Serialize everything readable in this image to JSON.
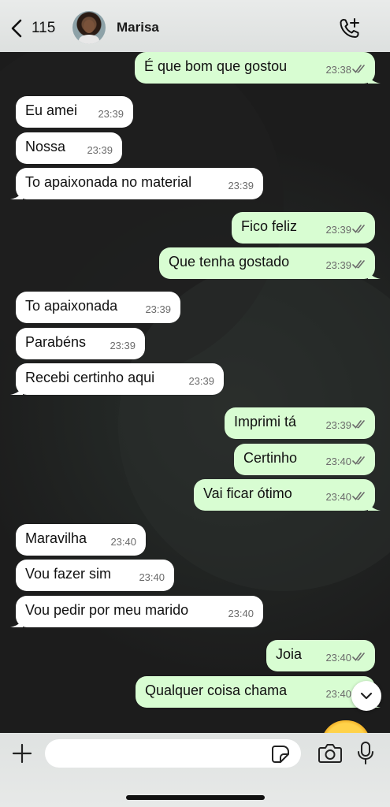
{
  "header": {
    "back_count": "115",
    "contact_name": "Marisa"
  },
  "messages": [
    {
      "text": "É que bom que gostou",
      "time": "23:38"
    },
    {
      "text": "Eu amei",
      "time": "23:39"
    },
    {
      "text": "Nossa",
      "time": "23:39"
    },
    {
      "text": "To apaixonada no material",
      "time": "23:39"
    },
    {
      "text": "Fico feliz",
      "time": "23:39"
    },
    {
      "text": "Que tenha gostado",
      "time": "23:39"
    },
    {
      "text": "To apaixonada",
      "time": "23:39"
    },
    {
      "text": "Parabéns",
      "time": "23:39"
    },
    {
      "text": "Recebi certinho aqui",
      "time": "23:39"
    },
    {
      "text": "Imprimi tá",
      "time": "23:39"
    },
    {
      "text": "Certinho",
      "time": "23:40"
    },
    {
      "text": "Vai ficar ótimo",
      "time": "23:40"
    },
    {
      "text": "Maravilha",
      "time": "23:40"
    },
    {
      "text": "Vou fazer sim",
      "time": "23:40"
    },
    {
      "text": "Vou pedir por meu marido",
      "time": "23:40"
    },
    {
      "text": "Joia",
      "time": "23:40"
    },
    {
      "text": "Qualquer coisa chama",
      "time": "23:40"
    }
  ],
  "composer": {
    "input_value": "",
    "input_placeholder": ""
  },
  "icons": {
    "back": "chevron-left-icon",
    "call": "phone-plus-icon",
    "plus": "plus-icon",
    "sticker": "sticker-icon",
    "camera": "camera-icon",
    "mic": "microphone-icon",
    "scroll": "chevron-down-icon"
  },
  "colors": {
    "incoming_bubble": "#ffffff",
    "outgoing_bubble": "#d8fdd2",
    "read_ticks": "#6b6b6b",
    "chat_background": "#1c1c1c"
  }
}
